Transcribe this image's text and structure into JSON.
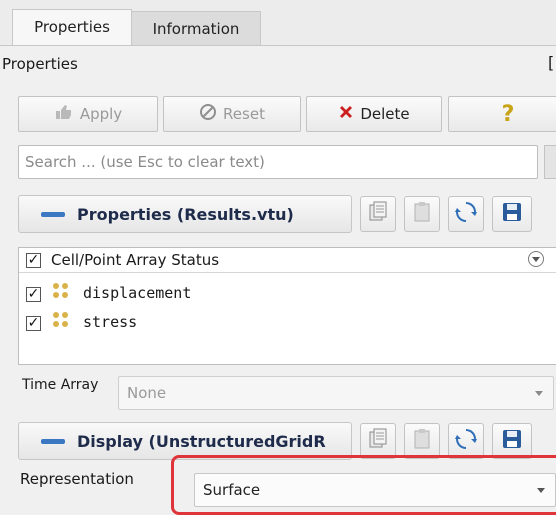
{
  "tabs": [
    {
      "label": "Properties",
      "active": true
    },
    {
      "label": "Information",
      "active": false
    }
  ],
  "panel_title": "Properties",
  "panel_title_right": "[",
  "toolbar": {
    "apply_label": "Apply",
    "reset_label": "Reset",
    "delete_label": "Delete",
    "help_label": "?"
  },
  "search": {
    "placeholder": "Search ... (use Esc to clear text)"
  },
  "properties_group": {
    "title": "Properties (Results.vtu)"
  },
  "array_status": {
    "header_label": "Cell/Point Array Status",
    "items": [
      {
        "label": "displacement",
        "checked": true
      },
      {
        "label": "stress",
        "checked": true
      }
    ]
  },
  "time_array": {
    "label": "Time Array",
    "value": "None"
  },
  "display_group": {
    "title": "Display (UnstructuredGridR"
  },
  "representation": {
    "label": "Representation",
    "value": "Surface"
  },
  "colors": {
    "accent": "#3b78c2",
    "delete_red": "#cc1f1f",
    "help_yellow": "#c8a419",
    "highlight": "#e0343b"
  }
}
